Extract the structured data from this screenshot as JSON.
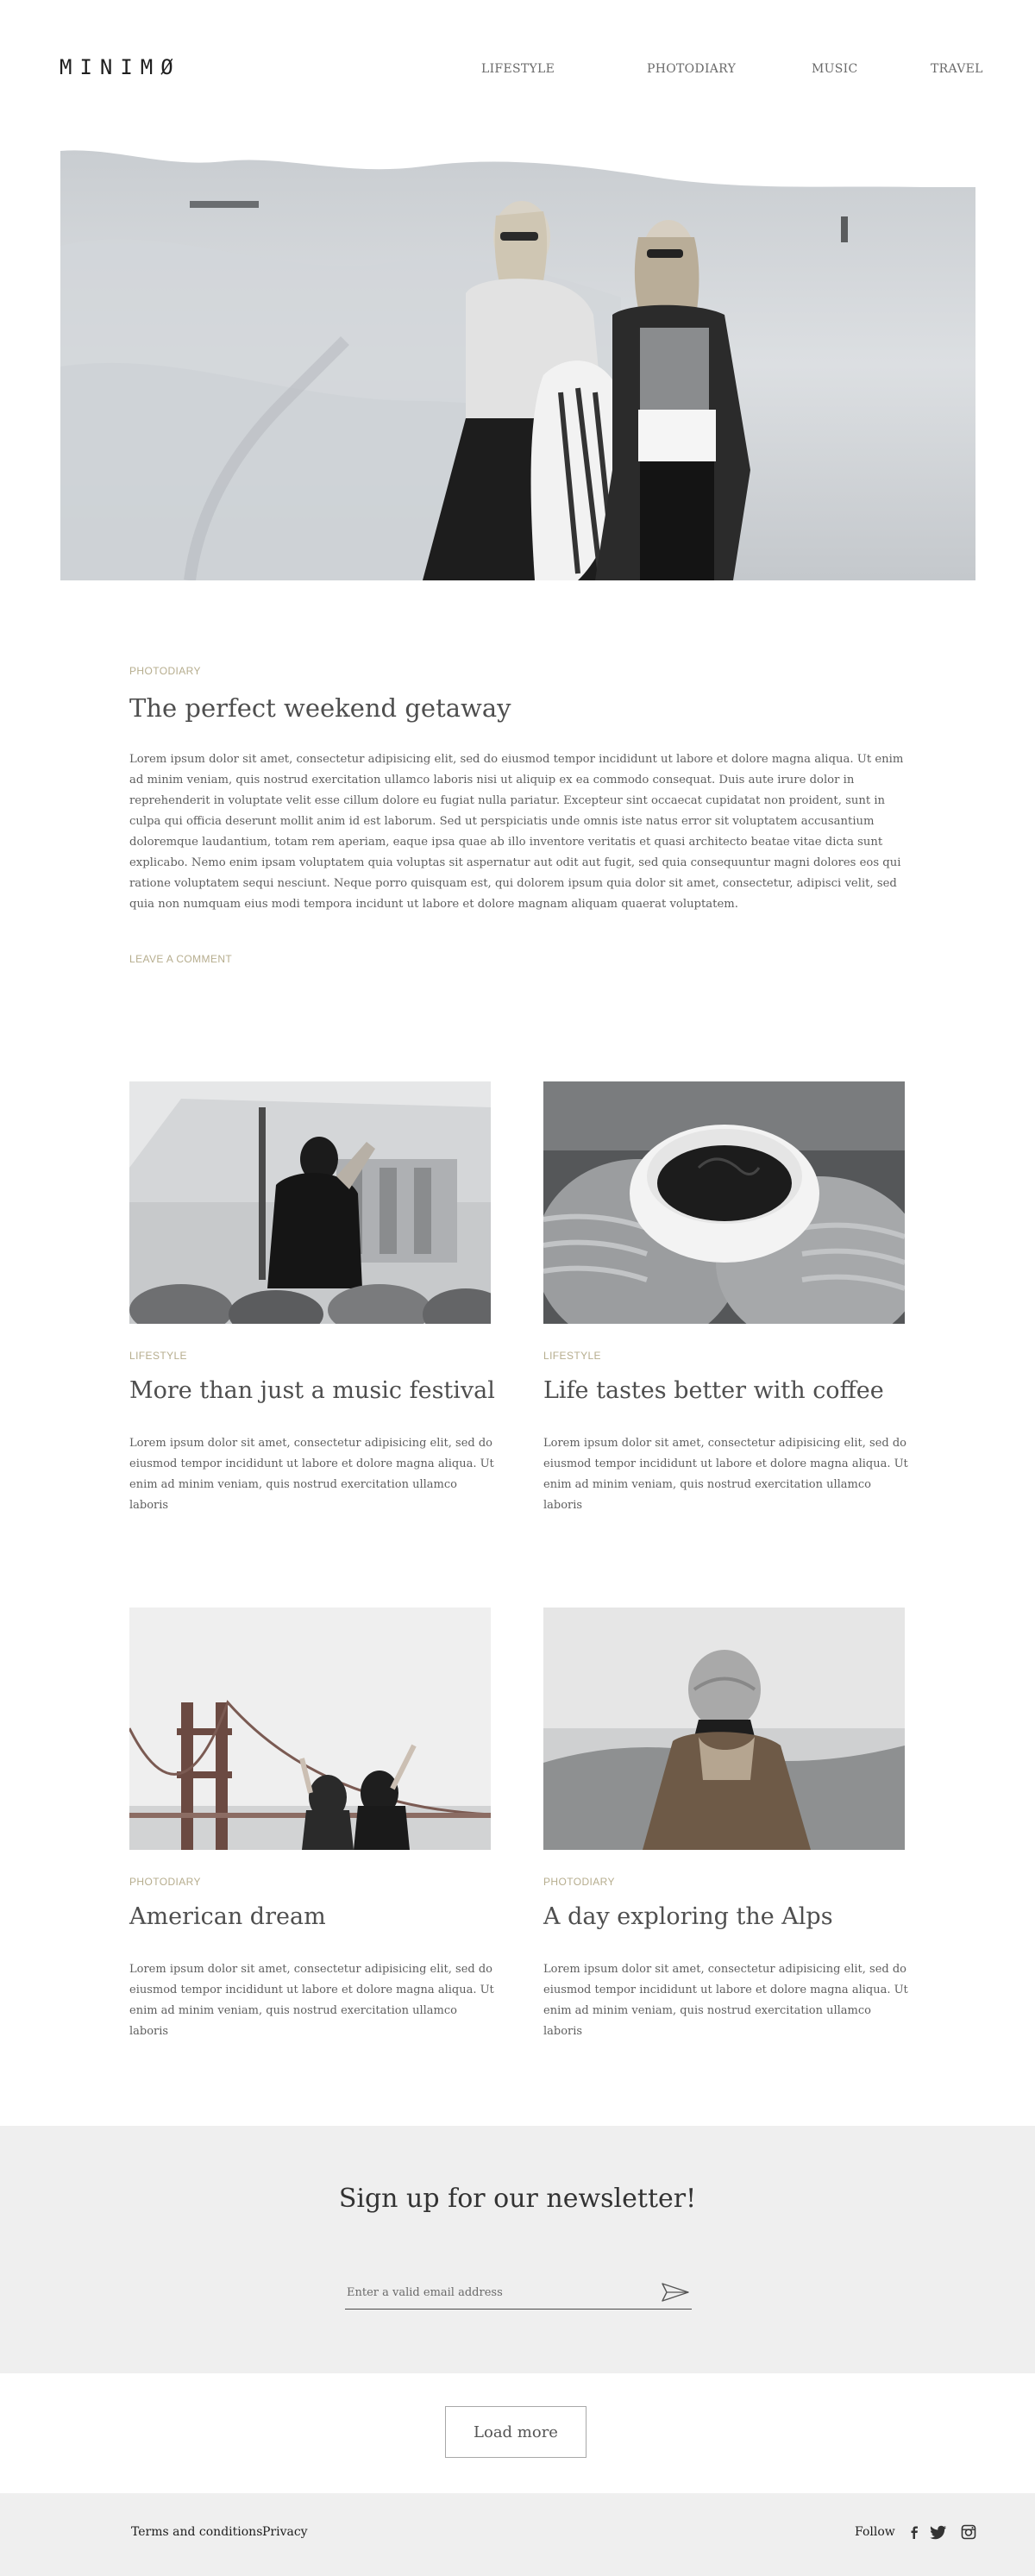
{
  "header": {
    "logo": "MINIMØ",
    "nav": [
      "LIFESTYLE",
      "PHOTODIARY",
      "MUSIC",
      "TRAVEL"
    ]
  },
  "hero": {
    "image": "two-women-in-snowy-dunes-photo"
  },
  "featured": {
    "category": "PHOTODIARY",
    "title": "The perfect weekend getaway",
    "body": "Lorem ipsum dolor sit amet, consectetur adipisicing elit, sed do eiusmod tempor incididunt ut labore et dolore magna aliqua. Ut enim ad minim veniam, quis nostrud exercitation ullamco laboris nisi ut aliquip ex ea commodo consequat. Duis aute irure dolor in reprehenderit in voluptate velit esse cillum dolore eu fugiat nulla pariatur. Excepteur sint occaecat cupidatat non proident, sunt in culpa qui officia deserunt mollit anim id est laborum. Sed ut perspiciatis unde omnis iste natus error sit voluptatem accusantium doloremque laudantium, totam rem aperiam, eaque ipsa quae ab illo inventore veritatis et quasi architecto beatae vitae dicta sunt explicabo. Nemo enim ipsam voluptatem quia voluptas sit aspernatur aut odit aut fugit, sed quia consequuntur magni dolores eos qui ratione voluptatem sequi nesciunt. Neque porro quisquam est, qui dolorem ipsum quia dolor sit amet, consectetur, adipisci velit, sed quia non numquam eius modi tempora incidunt ut labore et dolore magnam aliquam quaerat voluptatem.",
    "comment_link": "LEAVE A COMMENT"
  },
  "posts": [
    {
      "category": "LIFESTYLE",
      "title": "More than just a music festival",
      "excerpt": "Lorem ipsum dolor sit amet, consectetur adipisicing elit, sed do eiusmod tempor incididunt ut labore et dolore magna aliqua. Ut enim ad minim veniam, quis nostrud exercitation ullamco laboris",
      "image": "festival-crowd-photo"
    },
    {
      "category": "LIFESTYLE",
      "title": "Life tastes better with coffee",
      "excerpt": "Lorem ipsum dolor sit amet, consectetur adipisicing elit, sed do eiusmod tempor incididunt ut labore et dolore magna aliqua. Ut enim ad minim veniam, quis nostrud exercitation ullamco laboris",
      "image": "coffee-cup-in-mittens-photo"
    },
    {
      "category": "PHOTODIARY",
      "title": "American dream",
      "excerpt": "Lorem ipsum dolor sit amet, consectetur adipisicing elit, sed do eiusmod tempor incididunt ut labore et dolore magna aliqua. Ut enim ad minim veniam, quis nostrud exercitation ullamco laboris",
      "image": "golden-gate-bridge-photo"
    },
    {
      "category": "PHOTODIARY",
      "title": "A day exploring the Alps",
      "excerpt": "Lorem ipsum dolor sit amet, consectetur adipisicing elit, sed do eiusmod tempor incididunt ut labore et dolore magna aliqua. Ut enim ad minim veniam, quis nostrud exercitation ullamco laboris",
      "image": "hiker-in-beanie-photo"
    }
  ],
  "newsletter": {
    "title": "Sign up for our newsletter!",
    "placeholder": "Enter a valid email address",
    "send_icon": "paper-plane-icon"
  },
  "load_more": "Load more",
  "footer": {
    "links": [
      "Terms and conditions",
      "Privacy"
    ],
    "follow": "Follow",
    "social_icons": [
      "facebook-icon",
      "twitter-icon",
      "instagram-icon"
    ]
  }
}
